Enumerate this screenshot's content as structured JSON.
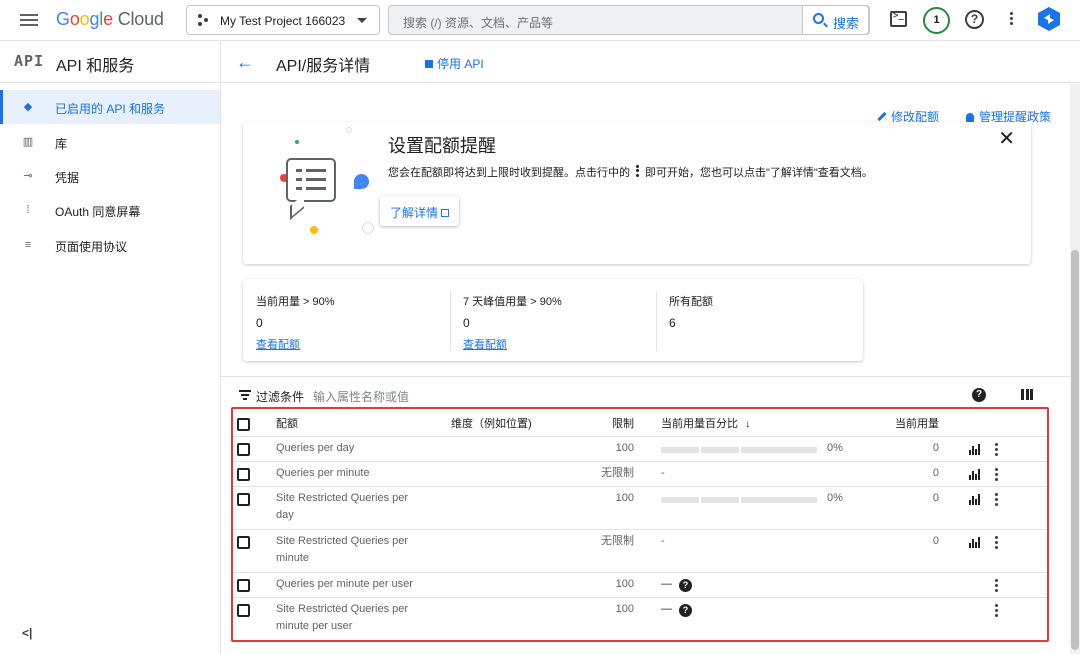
{
  "topbar": {
    "logo": {
      "g1": "G",
      "g2": "o",
      "g3": "o",
      "g4": "g",
      "g5": "l",
      "g6": "e",
      "cloud": "Cloud"
    },
    "project": "My Test Project 166023",
    "search_placeholder": "搜索 (/) 资源、文档、产品等",
    "search_button": "搜索",
    "notifications": "1",
    "help": "?"
  },
  "sidebar": {
    "badge": "API",
    "title": "API 和服务",
    "items": [
      {
        "label": "已启用的 API 和服务",
        "icon": "api-diamond-icon",
        "active": true
      },
      {
        "label": "库",
        "icon": "library-icon",
        "active": false
      },
      {
        "label": "凭据",
        "icon": "key-icon",
        "active": false
      },
      {
        "label": "OAuth 同意屏幕",
        "icon": "oauth-icon",
        "active": false
      },
      {
        "label": "页面使用协议",
        "icon": "page-settings-icon",
        "active": false
      }
    ],
    "collapse": "<|"
  },
  "header": {
    "back": "←",
    "title": "API/服务详情",
    "disable_api": "停用 API"
  },
  "actions": {
    "edit_quota": "修改配额",
    "manage_alerts": "管理提醒政策"
  },
  "alert": {
    "title": "设置配额提醒",
    "desc_before": "您会在配额即将达到上限时收到提醒。点击行中的",
    "desc_after": "即可开始，您也可以点击\"了解详情\"查看文档。",
    "learn_more": "了解详情",
    "close": "✕"
  },
  "stats": [
    {
      "label": "当前用量 > 90%",
      "value": "0",
      "link": "查看配额"
    },
    {
      "label": "7 天峰值用量 > 90%",
      "value": "0",
      "link": "查看配额"
    },
    {
      "label": "所有配额",
      "value": "6",
      "link": ""
    }
  ],
  "filter": {
    "label": "过滤条件",
    "placeholder": "输入属性名称或值"
  },
  "table": {
    "headers": {
      "quota": "配额",
      "dimension": "维度（例如位置)",
      "limit": "限制",
      "usage_pct": "当前用量百分比",
      "usage": "当前用量"
    },
    "rows": [
      {
        "quota_l1": "Queries per day",
        "quota_l2": "",
        "limit": "100",
        "pct": "0%",
        "usage": "0",
        "bar": true,
        "chart": true,
        "dash": false,
        "help": false
      },
      {
        "quota_l1": "Queries per minute",
        "quota_l2": "",
        "limit": "无限制",
        "pct": "-",
        "usage": "0",
        "bar": false,
        "chart": true,
        "dash": false,
        "help": false
      },
      {
        "quota_l1": "Site Restricted Queries per",
        "quota_l2": "day",
        "limit": "100",
        "pct": "0%",
        "usage": "0",
        "bar": true,
        "chart": true,
        "dash": false,
        "help": false
      },
      {
        "quota_l1": "Site Restricted Queries per",
        "quota_l2": "minute",
        "limit": "无限制",
        "pct": "-",
        "usage": "0",
        "bar": false,
        "chart": true,
        "dash": false,
        "help": false
      },
      {
        "quota_l1": "Queries per minute per user",
        "quota_l2": "",
        "limit": "100",
        "pct": "—",
        "usage": "",
        "bar": false,
        "chart": false,
        "dash": true,
        "help": true
      },
      {
        "quota_l1": "Site Restricted Queries per",
        "quota_l2": "minute per user",
        "limit": "100",
        "pct": "—",
        "usage": "",
        "bar": false,
        "chart": false,
        "dash": true,
        "help": true
      }
    ]
  },
  "colors": {
    "accent": "#1a73e8",
    "highlight": "#e53935",
    "active_bg": "#e8f0fe"
  }
}
